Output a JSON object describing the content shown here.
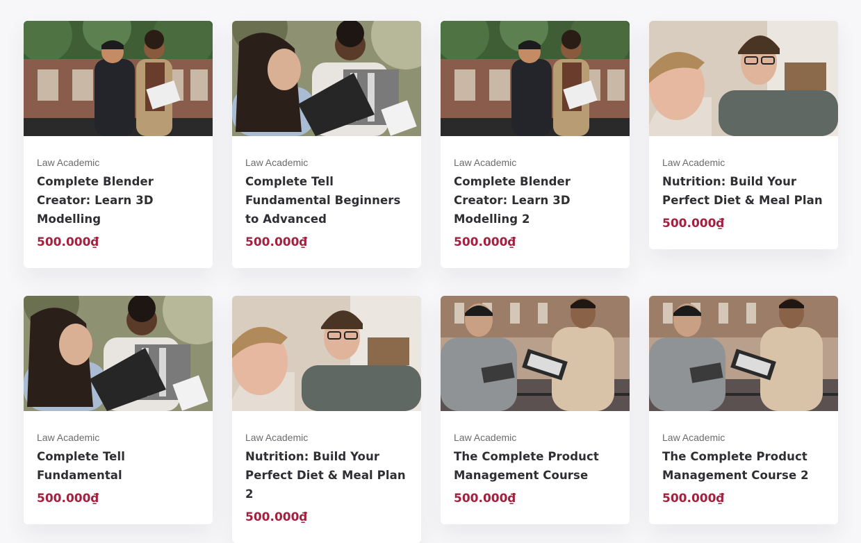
{
  "colors": {
    "background": "#f7f7f9",
    "card": "#ffffff",
    "title": "#2e2e33",
    "category": "#6b6b6b",
    "price": "#a3203e"
  },
  "courses": [
    {
      "category": "Law Academic",
      "title": "Complete Blender Creator: Learn 3D Modelling",
      "price": "500.000₫",
      "thumbnail": "two-men-reading-document"
    },
    {
      "category": "Law Academic",
      "title": "Complete Tell Fundamental Beginners to Advanced",
      "price": "500.000₫",
      "thumbnail": "two-women-with-folder"
    },
    {
      "category": "Law Academic",
      "title": "Complete Blender Creator: Learn 3D Modelling 2",
      "price": "500.000₫",
      "thumbnail": "two-men-reading-document"
    },
    {
      "category": "Law Academic",
      "title": "Nutrition: Build Your Perfect Diet & Meal Plan",
      "price": "500.000₫",
      "thumbnail": "two-young-men-talking"
    },
    {
      "category": "Law Academic",
      "title": "Complete Tell Fundamental",
      "price": "500.000₫",
      "thumbnail": "two-women-with-folder"
    },
    {
      "category": "Law Academic",
      "title": "Nutrition: Build Your Perfect Diet & Meal Plan 2",
      "price": "500.000₫",
      "thumbnail": "two-young-men-talking"
    },
    {
      "category": "Law Academic",
      "title": "The Complete Product Management Course",
      "price": "500.000₫",
      "thumbnail": "two-men-with-tablet"
    },
    {
      "category": "Law Academic",
      "title": "The Complete Product Management Course 2",
      "price": "500.000₫",
      "thumbnail": "two-men-with-tablet"
    }
  ]
}
